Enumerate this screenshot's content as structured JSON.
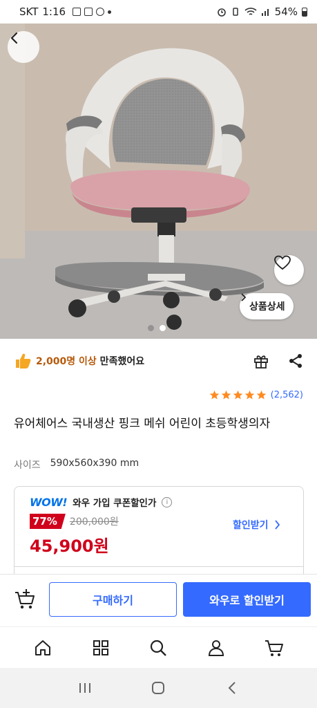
{
  "status_bar": {
    "carrier": "SKT",
    "time": "1:16",
    "battery": "54%"
  },
  "hero": {
    "detail_button_label": "상품상세",
    "page_count": 2,
    "active_page": 2
  },
  "satisfaction": {
    "highlight": "2,000명 이상",
    "text": " 만족했어요"
  },
  "rating": {
    "stars": 5,
    "review_count": "(2,562)",
    "star_color": "#ff8a1f"
  },
  "product": {
    "title": "유어체어스 국내생산 핑크 메쉬 어린이 초등학생의자",
    "size_label": "사이즈",
    "size_value": "590x560x390 mm"
  },
  "price": {
    "wow_logo": "WOW!",
    "wow_text": "와우 가입 쿠폰할인가",
    "discount": "77%",
    "original": "200,000원",
    "sale": "45,900원",
    "coupon_link": "할인받기"
  },
  "buy_bar": {
    "buy_label": "구매하기",
    "wow_discount_label": "와우로 할인받기"
  },
  "colors": {
    "accent": "#346aff",
    "price_red": "#d0021b",
    "wow_blue": "#0073e9"
  },
  "bottom_nav": [
    "home-icon",
    "category-icon",
    "search-icon",
    "my-page-icon",
    "cart-icon"
  ]
}
